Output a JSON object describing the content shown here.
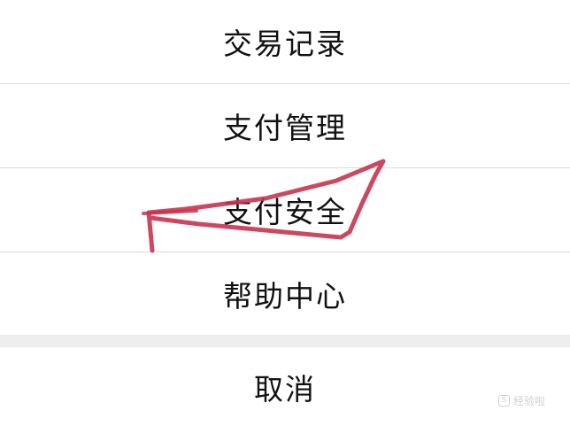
{
  "menu": {
    "items": [
      {
        "label": "交易记录"
      },
      {
        "label": "支付管理"
      },
      {
        "label": "支付安全"
      },
      {
        "label": "帮助中心"
      }
    ],
    "cancel_label": "取消"
  },
  "watermark": {
    "text": "经验啦"
  },
  "colors": {
    "text": "#111111",
    "divider": "#dcdcdc",
    "section_gap": "#eeeeee",
    "annotation_stroke": "#c8334f"
  }
}
